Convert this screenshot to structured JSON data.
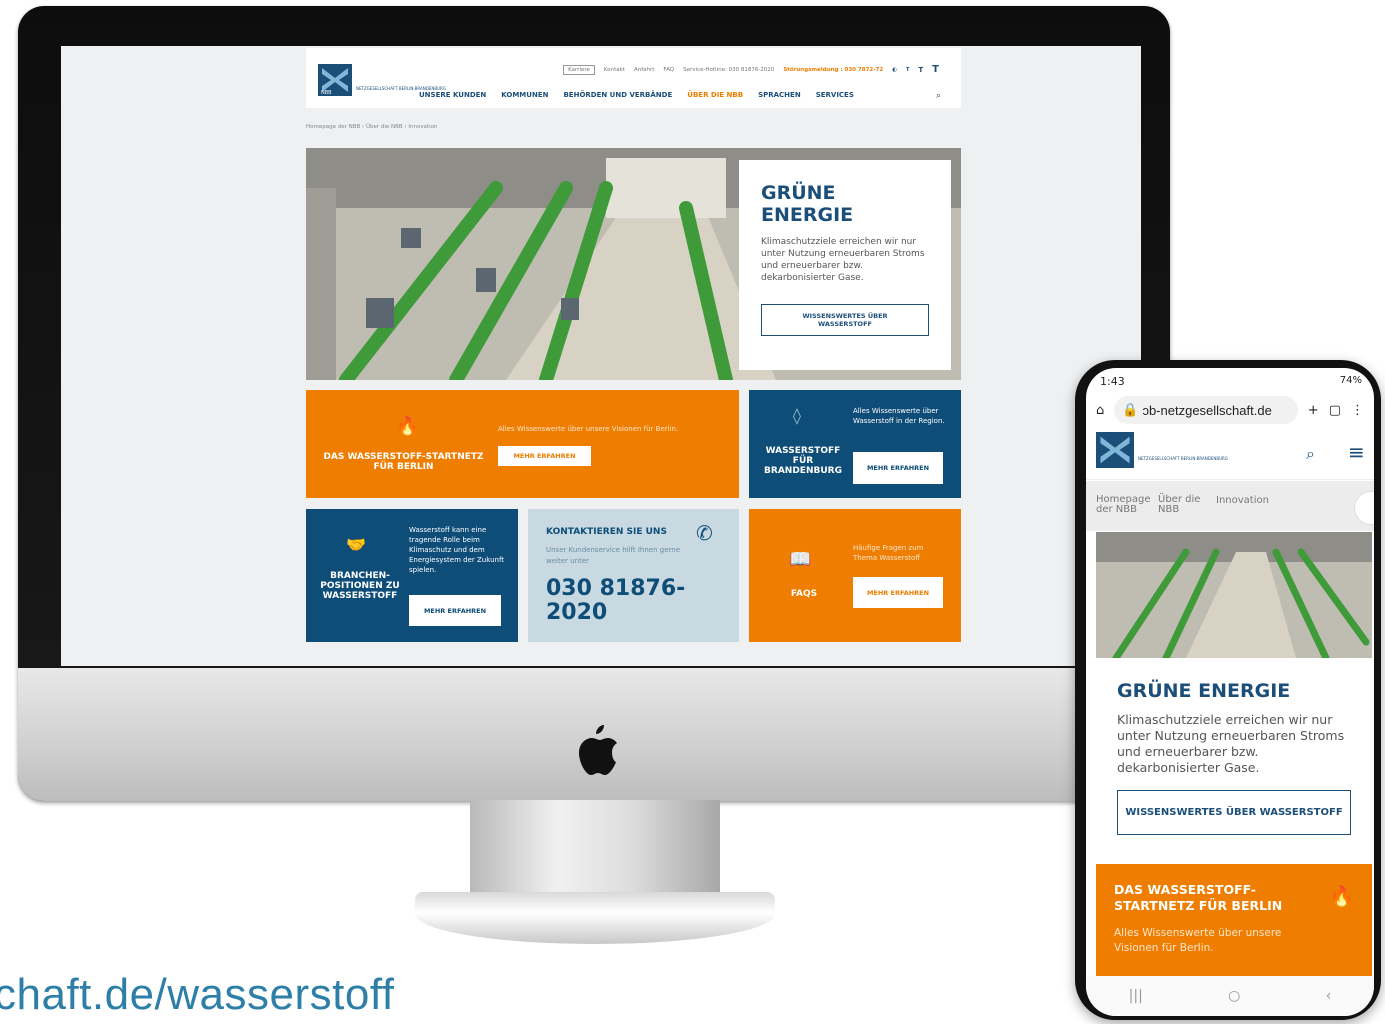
{
  "caption": "chaft.de/wasserstoff",
  "desktop": {
    "logo_text": "NETZGESELLSCHAFT BERLIN-BRANDENBURG",
    "topbar": {
      "karriere": "Karriere",
      "kontakt": "Kontakt",
      "anfahrt": "Anfahrt",
      "faq": "FAQ",
      "hotline": "Service-Hotline: 030 81876-2020",
      "stoerung": "Störungsmeldung : 030 7872-72",
      "contrast_icon": "contrast-icon",
      "font_sizes": [
        "T",
        "T",
        "T"
      ]
    },
    "nav": [
      "UNSERE KUNDEN",
      "KOMMUNEN",
      "BEHÖRDEN UND VERBÄNDE",
      "ÜBER DIE NBB",
      "SPRACHEN",
      "SERVICES"
    ],
    "breadcrumb": [
      "Homepage der NBB",
      "Über die NBB",
      "Innovation"
    ],
    "hero": {
      "title": "GRÜNE ENERGIE",
      "text": "Klimaschutzziele erreichen wir nur unter Nutzung erneuerbaren Stroms und erneuerbarer bzw. dekarbonisierter Gase.",
      "button": "WISSENSWERTES ÜBER WASSERSTOFF"
    },
    "tiles": {
      "startnetz": {
        "title": "DAS WASSERSTOFF-STARTNETZ FÜR BERLIN",
        "text": "Alles Wissenswerte über unsere Visionen für Berlin.",
        "button": "MEHR ERFAHREN"
      },
      "brandenburg": {
        "title": "WASSERSTOFF FÜR BRANDENBURG",
        "text": "Alles Wissenswerte über Wasserstoff in der Region.",
        "button": "MEHR ERFAHREN"
      },
      "branchen": {
        "title": "BRANCHEN-POSITIONEN ZU WASSERSTOFF",
        "text": "Wasserstoff kann eine tragende Rolle beim Klimaschutz und dem Energiesystem der Zukunft spielen.",
        "button": "MEHR ERFAHREN"
      },
      "kontakt": {
        "title": "KONTAKTIEREN SIE UNS",
        "text": "Unser Kundenservice hilft Ihnen gerne weiter unter",
        "phone": "030 81876-2020"
      },
      "faqs": {
        "title": "FAQS",
        "text": "Häufige Fragen zum Thema Wasserstoff",
        "button": "MEHR ERFAHREN"
      }
    }
  },
  "phone": {
    "time": "1:43",
    "battery": "74%",
    "url": "ɔb-netzgesellschaft.de",
    "logo_text": "NETZGESELLSCHAFT BERLIN-BRANDENBURG",
    "breadcrumb": [
      "Homepage der NBB",
      "Über die NBB",
      "Innovation"
    ],
    "title": "GRÜNE ENERGIE",
    "text": "Klimaschutzziele erreichen wir nur unter Nutzung erneuerbaren Stroms und erneuerbarer bzw. dekarbonisierter Gase.",
    "button": "WISSENSWERTES ÜBER WASSERSTOFF",
    "tile_title": "DAS WASSERSTOFF-STARTNETZ FÜR BERLIN",
    "tile_text": "Alles Wissenswerte über unsere Visionen für Berlin.",
    "nav_icons": [
      "recent-apps-icon",
      "home-icon",
      "back-icon"
    ]
  },
  "colors": {
    "brand_blue": "#1b4f7a",
    "brand_orange": "#ee7d00",
    "tile_blue": "#0e4d78",
    "tile_light": "#c8d9e2"
  }
}
